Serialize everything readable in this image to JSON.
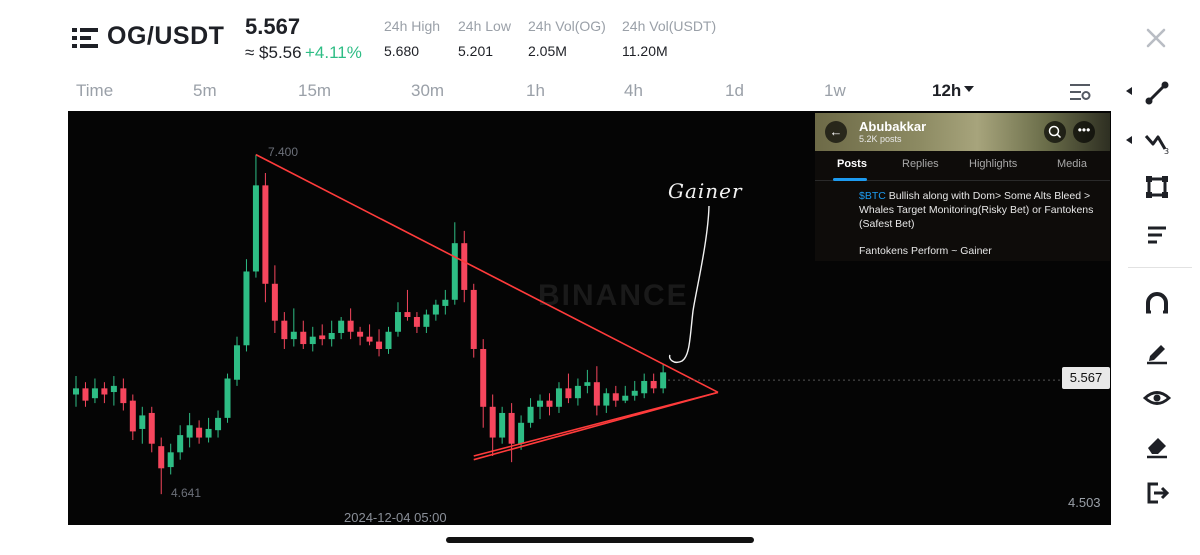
{
  "header": {
    "pair": "OG/USDT",
    "price": "5.567",
    "usd_price": "≈ $5.56",
    "change": "+4.11%",
    "stats": [
      {
        "label": "24h High",
        "value": "5.680"
      },
      {
        "label": "24h Low",
        "value": "5.201"
      },
      {
        "label": "24h Vol(OG)",
        "value": "2.05M"
      },
      {
        "label": "24h Vol(USDT)",
        "value": "11.20M"
      }
    ]
  },
  "timeframes": {
    "items": [
      "Time",
      "5m",
      "15m",
      "30m",
      "1h",
      "4h",
      "1d",
      "1w",
      "12h"
    ],
    "selected": "12h"
  },
  "chart": {
    "current_price_tag": "5.567",
    "axis_low_label": "4.503",
    "time_label": "2024-12-04 05:00",
    "high_marker": "7.400",
    "low_marker": "4.641",
    "watermark": "BINANCE",
    "annotation": "Gainer"
  },
  "chart_data": {
    "type": "candlestick",
    "interval": "12h",
    "ylim": [
      4.503,
      7.6
    ],
    "candles": [
      {
        "o": 5.45,
        "h": 5.6,
        "l": 5.35,
        "c": 5.5
      },
      {
        "o": 5.5,
        "h": 5.55,
        "l": 5.35,
        "c": 5.4
      },
      {
        "o": 5.42,
        "h": 5.58,
        "l": 5.38,
        "c": 5.5
      },
      {
        "o": 5.5,
        "h": 5.55,
        "l": 5.38,
        "c": 5.45
      },
      {
        "o": 5.47,
        "h": 5.6,
        "l": 5.36,
        "c": 5.52
      },
      {
        "o": 5.5,
        "h": 5.58,
        "l": 5.32,
        "c": 5.38
      },
      {
        "o": 5.4,
        "h": 5.45,
        "l": 5.08,
        "c": 5.15
      },
      {
        "o": 5.17,
        "h": 5.35,
        "l": 5.05,
        "c": 5.28
      },
      {
        "o": 5.3,
        "h": 5.35,
        "l": 4.98,
        "c": 5.05
      },
      {
        "o": 5.03,
        "h": 5.1,
        "l": 4.64,
        "c": 4.85
      },
      {
        "o": 4.86,
        "h": 5.05,
        "l": 4.8,
        "c": 4.98
      },
      {
        "o": 4.98,
        "h": 5.2,
        "l": 4.92,
        "c": 5.12
      },
      {
        "o": 5.1,
        "h": 5.3,
        "l": 5.02,
        "c": 5.2
      },
      {
        "o": 5.18,
        "h": 5.24,
        "l": 5.05,
        "c": 5.1
      },
      {
        "o": 5.1,
        "h": 5.26,
        "l": 5.06,
        "c": 5.17
      },
      {
        "o": 5.16,
        "h": 5.32,
        "l": 5.1,
        "c": 5.26
      },
      {
        "o": 5.26,
        "h": 5.62,
        "l": 5.22,
        "c": 5.58
      },
      {
        "o": 5.57,
        "h": 5.92,
        "l": 5.52,
        "c": 5.85
      },
      {
        "o": 5.85,
        "h": 6.55,
        "l": 5.8,
        "c": 6.45
      },
      {
        "o": 6.45,
        "h": 7.4,
        "l": 6.4,
        "c": 7.15
      },
      {
        "o": 7.15,
        "h": 7.25,
        "l": 6.2,
        "c": 6.35
      },
      {
        "o": 6.35,
        "h": 6.5,
        "l": 5.95,
        "c": 6.05
      },
      {
        "o": 6.05,
        "h": 6.12,
        "l": 5.82,
        "c": 5.9
      },
      {
        "o": 5.9,
        "h": 6.15,
        "l": 5.84,
        "c": 5.96
      },
      {
        "o": 5.96,
        "h": 6.05,
        "l": 5.82,
        "c": 5.86
      },
      {
        "o": 5.86,
        "h": 6.0,
        "l": 5.8,
        "c": 5.92
      },
      {
        "o": 5.93,
        "h": 6.02,
        "l": 5.85,
        "c": 5.9
      },
      {
        "o": 5.9,
        "h": 6.05,
        "l": 5.84,
        "c": 5.95
      },
      {
        "o": 5.95,
        "h": 6.08,
        "l": 5.9,
        "c": 6.05
      },
      {
        "o": 6.05,
        "h": 6.15,
        "l": 5.9,
        "c": 5.96
      },
      {
        "o": 5.96,
        "h": 6.0,
        "l": 5.85,
        "c": 5.92
      },
      {
        "o": 5.92,
        "h": 6.02,
        "l": 5.85,
        "c": 5.88
      },
      {
        "o": 5.88,
        "h": 5.98,
        "l": 5.76,
        "c": 5.82
      },
      {
        "o": 5.82,
        "h": 6.0,
        "l": 5.78,
        "c": 5.96
      },
      {
        "o": 5.96,
        "h": 6.2,
        "l": 5.92,
        "c": 6.12
      },
      {
        "o": 6.12,
        "h": 6.3,
        "l": 6.05,
        "c": 6.08
      },
      {
        "o": 6.08,
        "h": 6.12,
        "l": 5.95,
        "c": 6.0
      },
      {
        "o": 6.0,
        "h": 6.14,
        "l": 5.95,
        "c": 6.1
      },
      {
        "o": 6.1,
        "h": 6.22,
        "l": 6.05,
        "c": 6.18
      },
      {
        "o": 6.17,
        "h": 6.3,
        "l": 6.1,
        "c": 6.22
      },
      {
        "o": 6.22,
        "h": 6.85,
        "l": 6.18,
        "c": 6.68
      },
      {
        "o": 6.68,
        "h": 6.78,
        "l": 6.2,
        "c": 6.3
      },
      {
        "o": 6.3,
        "h": 6.35,
        "l": 5.75,
        "c": 5.82
      },
      {
        "o": 5.82,
        "h": 5.9,
        "l": 5.18,
        "c": 5.35
      },
      {
        "o": 5.35,
        "h": 5.45,
        "l": 4.95,
        "c": 5.1
      },
      {
        "o": 5.1,
        "h": 5.35,
        "l": 5.05,
        "c": 5.3
      },
      {
        "o": 5.3,
        "h": 5.38,
        "l": 4.9,
        "c": 5.05
      },
      {
        "o": 5.05,
        "h": 5.28,
        "l": 5.0,
        "c": 5.22
      },
      {
        "o": 5.22,
        "h": 5.42,
        "l": 5.18,
        "c": 5.35
      },
      {
        "o": 5.35,
        "h": 5.45,
        "l": 5.25,
        "c": 5.4
      },
      {
        "o": 5.4,
        "h": 5.46,
        "l": 5.28,
        "c": 5.35
      },
      {
        "o": 5.35,
        "h": 5.55,
        "l": 5.3,
        "c": 5.5
      },
      {
        "o": 5.5,
        "h": 5.62,
        "l": 5.38,
        "c": 5.42
      },
      {
        "o": 5.42,
        "h": 5.58,
        "l": 5.36,
        "c": 5.52
      },
      {
        "o": 5.52,
        "h": 5.65,
        "l": 5.46,
        "c": 5.55
      },
      {
        "o": 5.55,
        "h": 5.68,
        "l": 5.28,
        "c": 5.36
      },
      {
        "o": 5.36,
        "h": 5.5,
        "l": 5.3,
        "c": 5.46
      },
      {
        "o": 5.46,
        "h": 5.52,
        "l": 5.35,
        "c": 5.4
      },
      {
        "o": 5.4,
        "h": 5.52,
        "l": 5.38,
        "c": 5.44
      },
      {
        "o": 5.44,
        "h": 5.56,
        "l": 5.4,
        "c": 5.48
      },
      {
        "o": 5.46,
        "h": 5.62,
        "l": 5.42,
        "c": 5.56
      },
      {
        "o": 5.56,
        "h": 5.62,
        "l": 5.46,
        "c": 5.5
      },
      {
        "o": 5.5,
        "h": 5.7,
        "l": 5.46,
        "c": 5.63
      }
    ],
    "trendlines": [
      {
        "from": [
          19,
          7.4
        ],
        "to": [
          66,
          5.5
        ]
      },
      {
        "from": [
          42,
          4.95
        ],
        "to": [
          66,
          5.5
        ]
      },
      {
        "from": [
          42,
          4.92
        ],
        "to": [
          66,
          5.5
        ]
      }
    ],
    "current_price": 5.567
  },
  "tweet": {
    "name": "Abubakkar",
    "posts": "5.2K posts",
    "tabs": [
      "Posts",
      "Replies",
      "Highlights",
      "Media"
    ],
    "tag": "$BTC",
    "body": " Bullish along with Dom> Some Alts Bleed > Whales Target Monitoring(Risky Bet) or Fantokens (Safest Bet)",
    "line2": "Fantokens Perform ~ Gainer"
  },
  "toolbar": {
    "tools": [
      "trendline-icon",
      "wave-icon",
      "rectangle-icon",
      "text-lines-icon",
      "magnet-icon",
      "pen-icon",
      "eye-icon",
      "eraser-icon",
      "exit-icon"
    ]
  },
  "colors": {
    "up": "#2ebd85",
    "down": "#f6465d",
    "trendline": "#ff3b3b",
    "chart_bg": "#050505"
  }
}
